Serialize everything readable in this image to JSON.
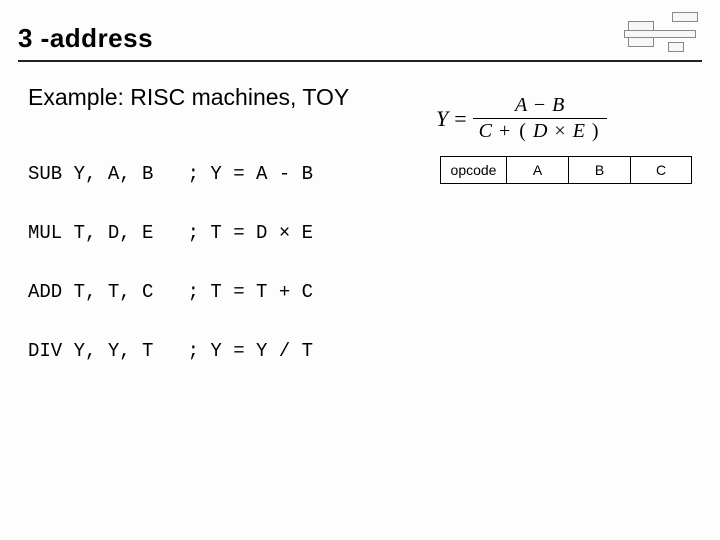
{
  "title": "3 -address",
  "example_label": "Example: RISC machines, TOY",
  "code": {
    "line1": "SUB Y, A, B   ; Y = A - B",
    "line2": "MUL T, D, E   ; T = D × E",
    "line3": "ADD T, T, C   ; T = T + C",
    "line4": "DIV Y, Y, T   ; Y = Y / T"
  },
  "formula": {
    "lhs": "Y",
    "eq": "=",
    "numerator": {
      "a": "A",
      "minus": "−",
      "b": "B"
    },
    "denominator": {
      "c": "C",
      "plus": "+",
      "lp": "(",
      "d": "D",
      "times": "×",
      "e": "E",
      "rp": ")"
    }
  },
  "instr_format": {
    "opcode": "opcode",
    "a": "A",
    "b": "B",
    "c": "C"
  }
}
